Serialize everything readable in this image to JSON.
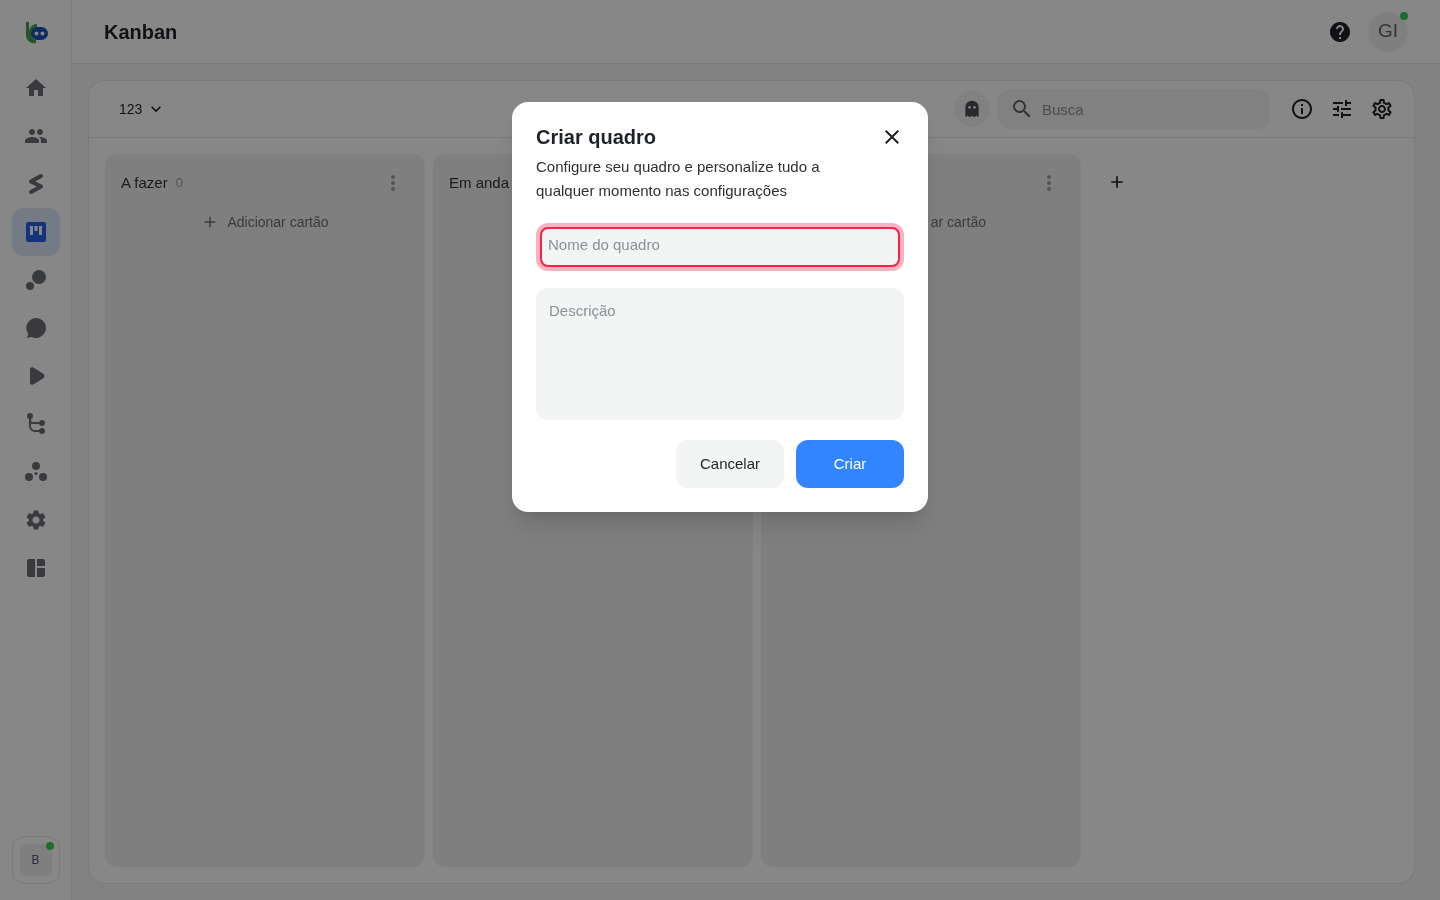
{
  "sidebar": {
    "items": [
      {
        "selected": false
      },
      {
        "selected": false
      },
      {
        "selected": false
      },
      {
        "selected": true
      },
      {
        "selected": false
      },
      {
        "selected": false
      },
      {
        "selected": false
      },
      {
        "selected": false
      },
      {
        "selected": false
      },
      {
        "selected": false
      },
      {
        "selected": false
      }
    ],
    "account": {
      "initial": "B",
      "online": true
    }
  },
  "header": {
    "title": "Kanban",
    "avatar": {
      "initials": "GI",
      "online": true
    }
  },
  "toolbar": {
    "board_selector": "123",
    "search": {
      "placeholder": "Busca"
    }
  },
  "columns": [
    {
      "title": "A fazer",
      "count": "0",
      "menu": true,
      "add_card": {
        "label": "Adicionar cartão",
        "icon": true
      }
    },
    {
      "title": "Em anda"
    },
    {
      "menu": true,
      "add_card": {
        "label": "ar cartão",
        "icon": false
      }
    }
  ],
  "modal": {
    "title": "Criar quadro",
    "description": "Configure seu quadro e personalize tudo a qualquer momento nas configurações",
    "fields": [
      {
        "kind": "input",
        "placeholder": "Nome do quadro",
        "invalid": true
      },
      {
        "kind": "textarea",
        "placeholder": "Descrição"
      }
    ],
    "buttons": [
      {
        "kind": "secondary",
        "label": "Cancelar"
      },
      {
        "kind": "primary",
        "label": "Criar"
      }
    ]
  }
}
